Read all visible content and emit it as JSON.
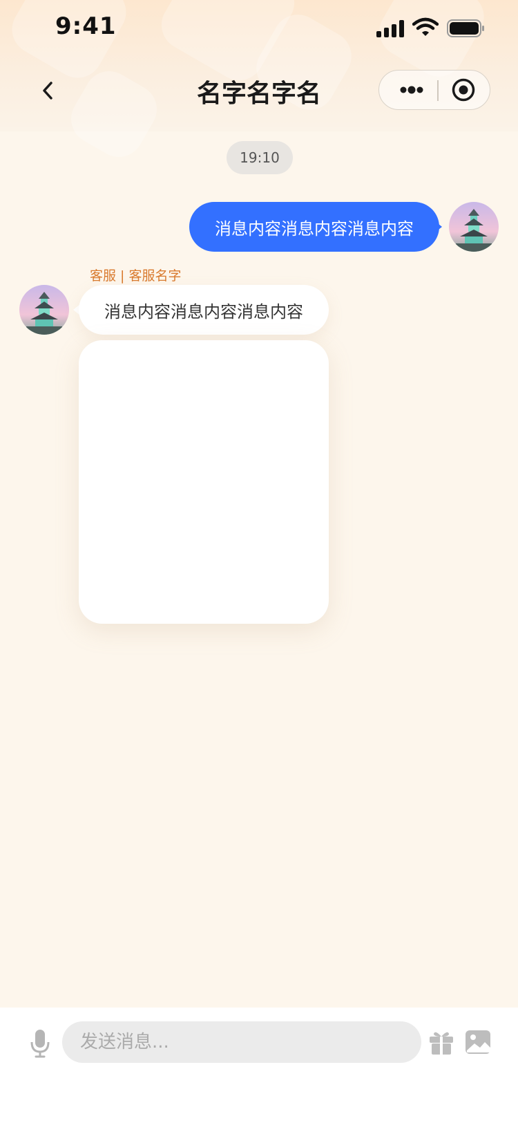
{
  "status_bar": {
    "time": "9:41",
    "icons": [
      "signal-icon",
      "wifi-icon",
      "battery-icon"
    ]
  },
  "nav": {
    "title": "名字名字名",
    "back_icon": "back-icon",
    "capsule_icons": [
      "more-icon",
      "close-miniprogram-icon"
    ]
  },
  "chat": {
    "timestamp": "19:10",
    "messages": [
      {
        "direction": "outgoing",
        "text": "消息内容消息内容消息内容",
        "avatar_icon": "pagoda-avatar"
      },
      {
        "direction": "incoming",
        "sender": "客服 | 客服名字",
        "text": "消息内容消息内容消息内容",
        "avatar_icon": "pagoda-avatar"
      },
      {
        "direction": "incoming",
        "type": "card"
      }
    ]
  },
  "input_bar": {
    "placeholder": "发送消息...",
    "icons": [
      "microphone-icon",
      "gift-icon",
      "image-icon"
    ]
  },
  "colors": {
    "accent": "#3370ff",
    "sender_label": "#d97a2e",
    "background": "#fdf6ec",
    "header_gradient_top": "#fde7cf"
  }
}
